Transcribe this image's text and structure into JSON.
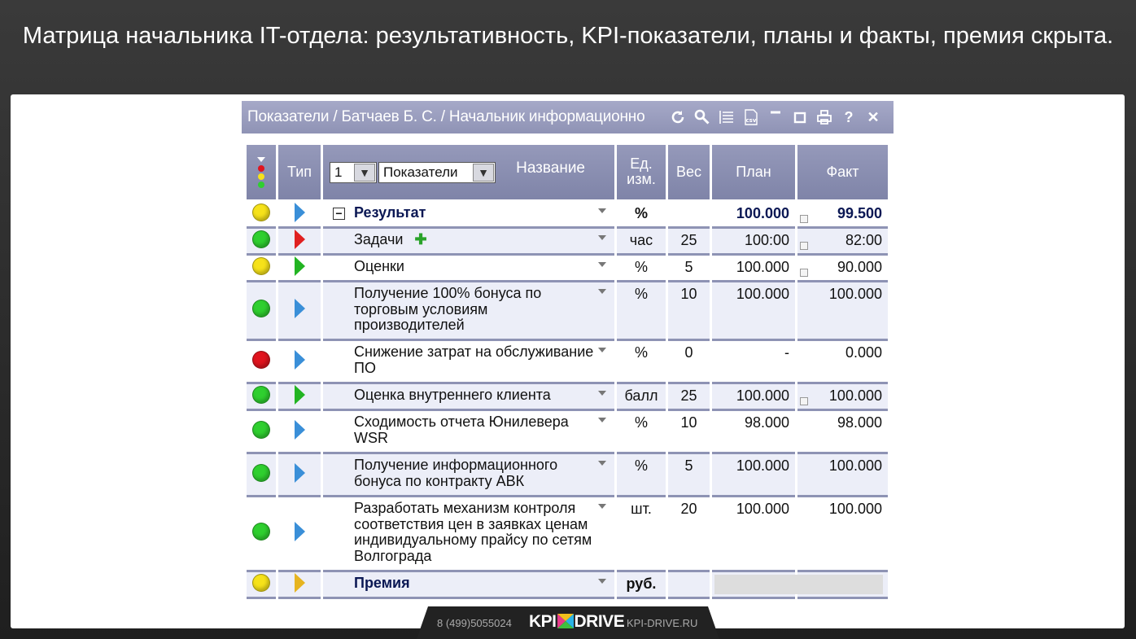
{
  "slide": {
    "title": "Матрица начальника IT-отдела: результативность, KPI-показатели, планы и факты, премия скрыта."
  },
  "window": {
    "title": "Показатели / Батчаев  Б. С. / Начальник информационно"
  },
  "toolbar": {
    "icons": [
      "refresh-icon",
      "search-icon",
      "list-icon",
      "csv-icon",
      "minimize-icon",
      "maximize-icon",
      "print-icon",
      "help-icon",
      "close-icon"
    ],
    "csv_label": "csv",
    "help_label": "?",
    "close_label": "✕"
  },
  "table": {
    "level_value": "1",
    "view_value": "Показатели",
    "headers": {
      "type": "Тип",
      "name": "Название",
      "unit": "Ед. изм.",
      "weight": "Вес",
      "plan": "План",
      "fact": "Факт"
    },
    "rows": [
      {
        "status": "yellow",
        "type_color": "#3a8fd8",
        "name": "Результат",
        "bold": true,
        "collapsible": true,
        "unit": "%",
        "weight": "",
        "plan": "100.000",
        "fact": "99.500",
        "fact_mark": true
      },
      {
        "status": "green",
        "type_color": "#e02020",
        "name": "Задачи",
        "has_plus": true,
        "unit": "час",
        "weight": "25",
        "plan": "100:00",
        "fact": "82:00",
        "fact_mark": true
      },
      {
        "status": "yellow",
        "type_color": "#22b422",
        "name": "Оценки",
        "unit": "%",
        "weight": "5",
        "plan": "100.000",
        "fact": "90.000",
        "fact_mark": true
      },
      {
        "status": "green",
        "type_color": "#3a8fd8",
        "name": "Получение 100% бонуса по торговым условиям производителей",
        "unit": "%",
        "weight": "10",
        "plan": "100.000",
        "fact": "100.000"
      },
      {
        "status": "red",
        "type_color": "#3a8fd8",
        "name": "Снижение затрат на обслуживание ПО",
        "unit": "%",
        "weight": "0",
        "plan": "-",
        "fact": "0.000"
      },
      {
        "status": "green",
        "type_color": "#22b422",
        "name": "Оценка внутреннего клиента",
        "unit": "балл",
        "weight": "25",
        "plan": "100.000",
        "fact": "100.000",
        "fact_mark": true
      },
      {
        "status": "green",
        "type_color": "#3a8fd8",
        "name": "Сходимость отчета Юнилевера WSR",
        "unit": "%",
        "weight": "10",
        "plan": "98.000",
        "fact": "98.000"
      },
      {
        "status": "green",
        "type_color": "#3a8fd8",
        "name": "Получение информационного бонуса по контракту АВК",
        "unit": "%",
        "weight": "5",
        "plan": "100.000",
        "fact": "100.000"
      },
      {
        "status": "green",
        "type_color": "#3a8fd8",
        "name": "Разработать механизм контроля соответствия цен в заявках ценам индивидуальному прайсу по сетям Волгограда",
        "unit": "шт.",
        "weight": "20",
        "plan": "100.000",
        "fact": "100.000"
      },
      {
        "status": "yellow",
        "type_color": "#e6b420",
        "name": "Премия",
        "bold": true,
        "unit": "руб.",
        "weight": "",
        "plan": "",
        "fact": "",
        "hidden_value": true
      }
    ]
  },
  "colors": {
    "green": "#2fcf2f",
    "yellow": "#f6e21a",
    "red": "#e0141e",
    "header": "#8a8fb1"
  },
  "footer": {
    "phone": "8 (499)5055024",
    "logo_left": "KPI",
    "logo_right": "DRIVE",
    "site": "KPI-DRIVE.RU"
  }
}
